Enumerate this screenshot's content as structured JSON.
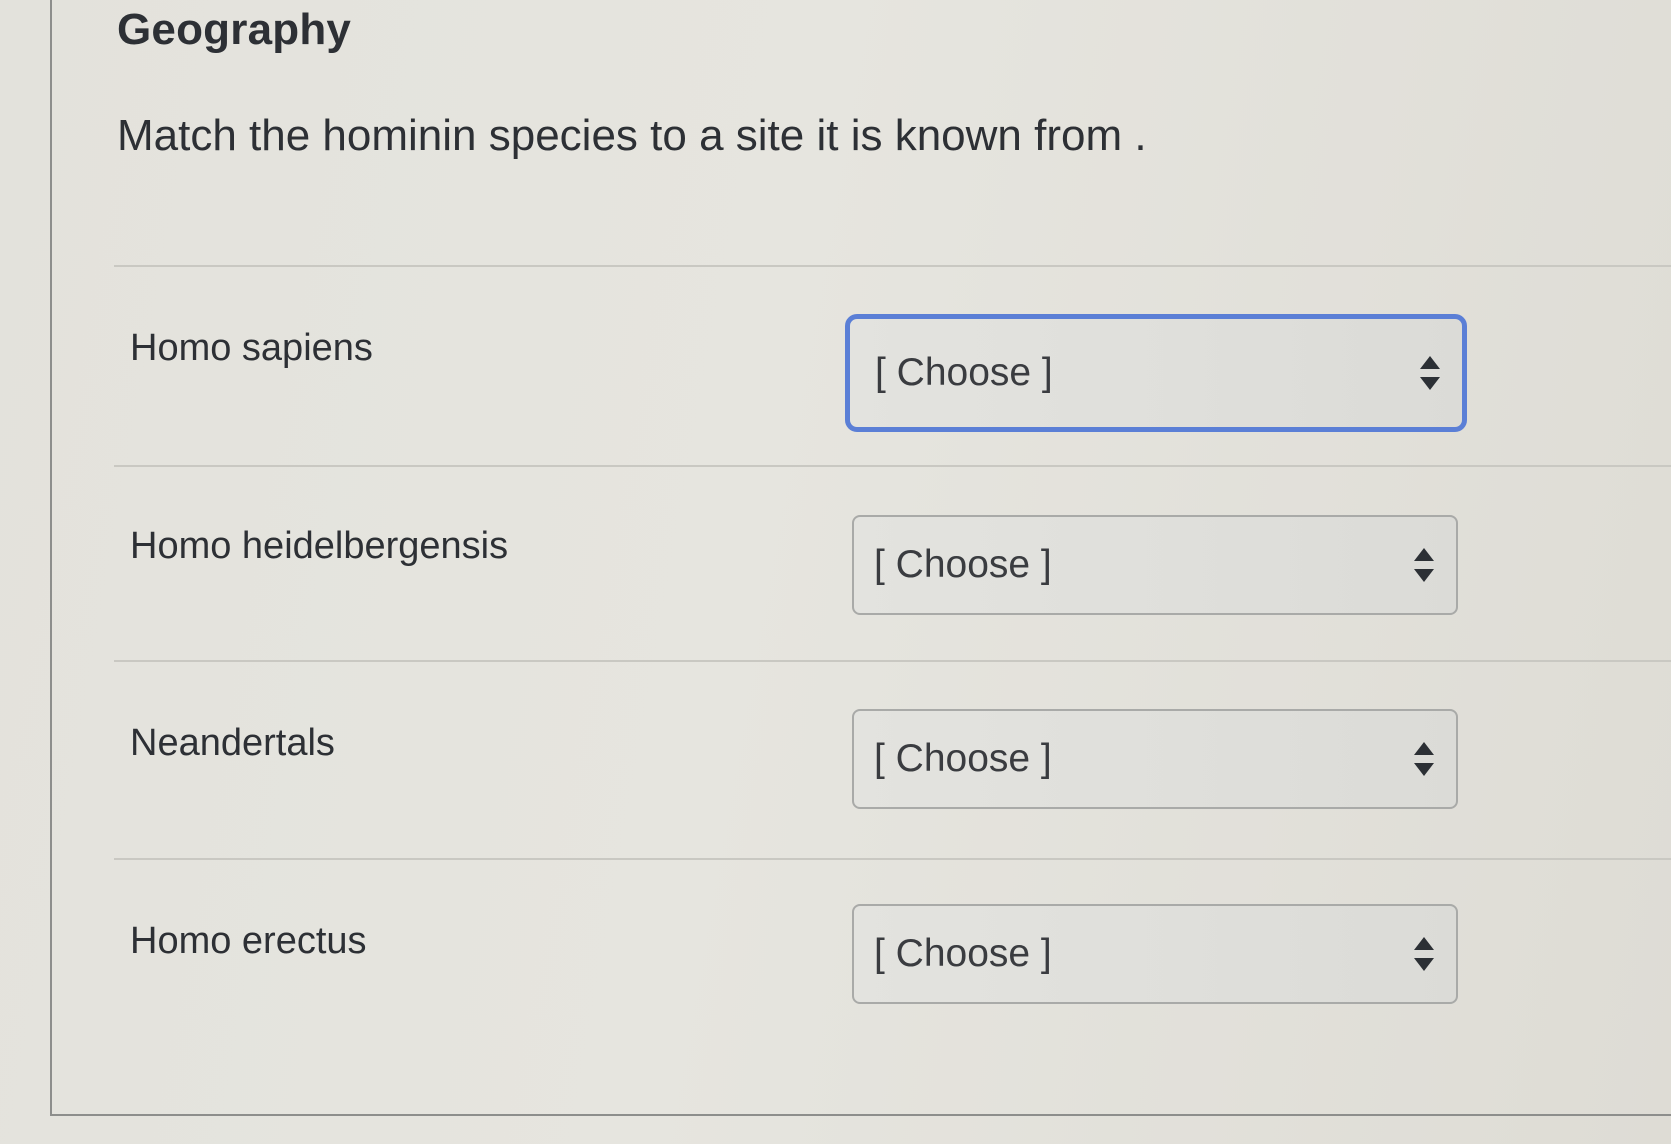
{
  "quiz": {
    "title": "Geography",
    "prompt": "Match the hominin species to a site it is known from ."
  },
  "rows": [
    {
      "label": "Homo sapiens",
      "select_value": "[ Choose ]",
      "focused": true
    },
    {
      "label": "Homo heidelbergensis",
      "select_value": "[ Choose ]",
      "focused": false
    },
    {
      "label": "Neandertals",
      "select_value": "[ Choose ]",
      "focused": false
    },
    {
      "label": "Homo erectus",
      "select_value": "[ Choose ]",
      "focused": false
    }
  ],
  "icons": {
    "select_indicator": "up-down-stepper-icon"
  },
  "colors": {
    "focus_ring": "#5b7fd6",
    "text": "#2d3035",
    "background": "#e3e2dc"
  }
}
